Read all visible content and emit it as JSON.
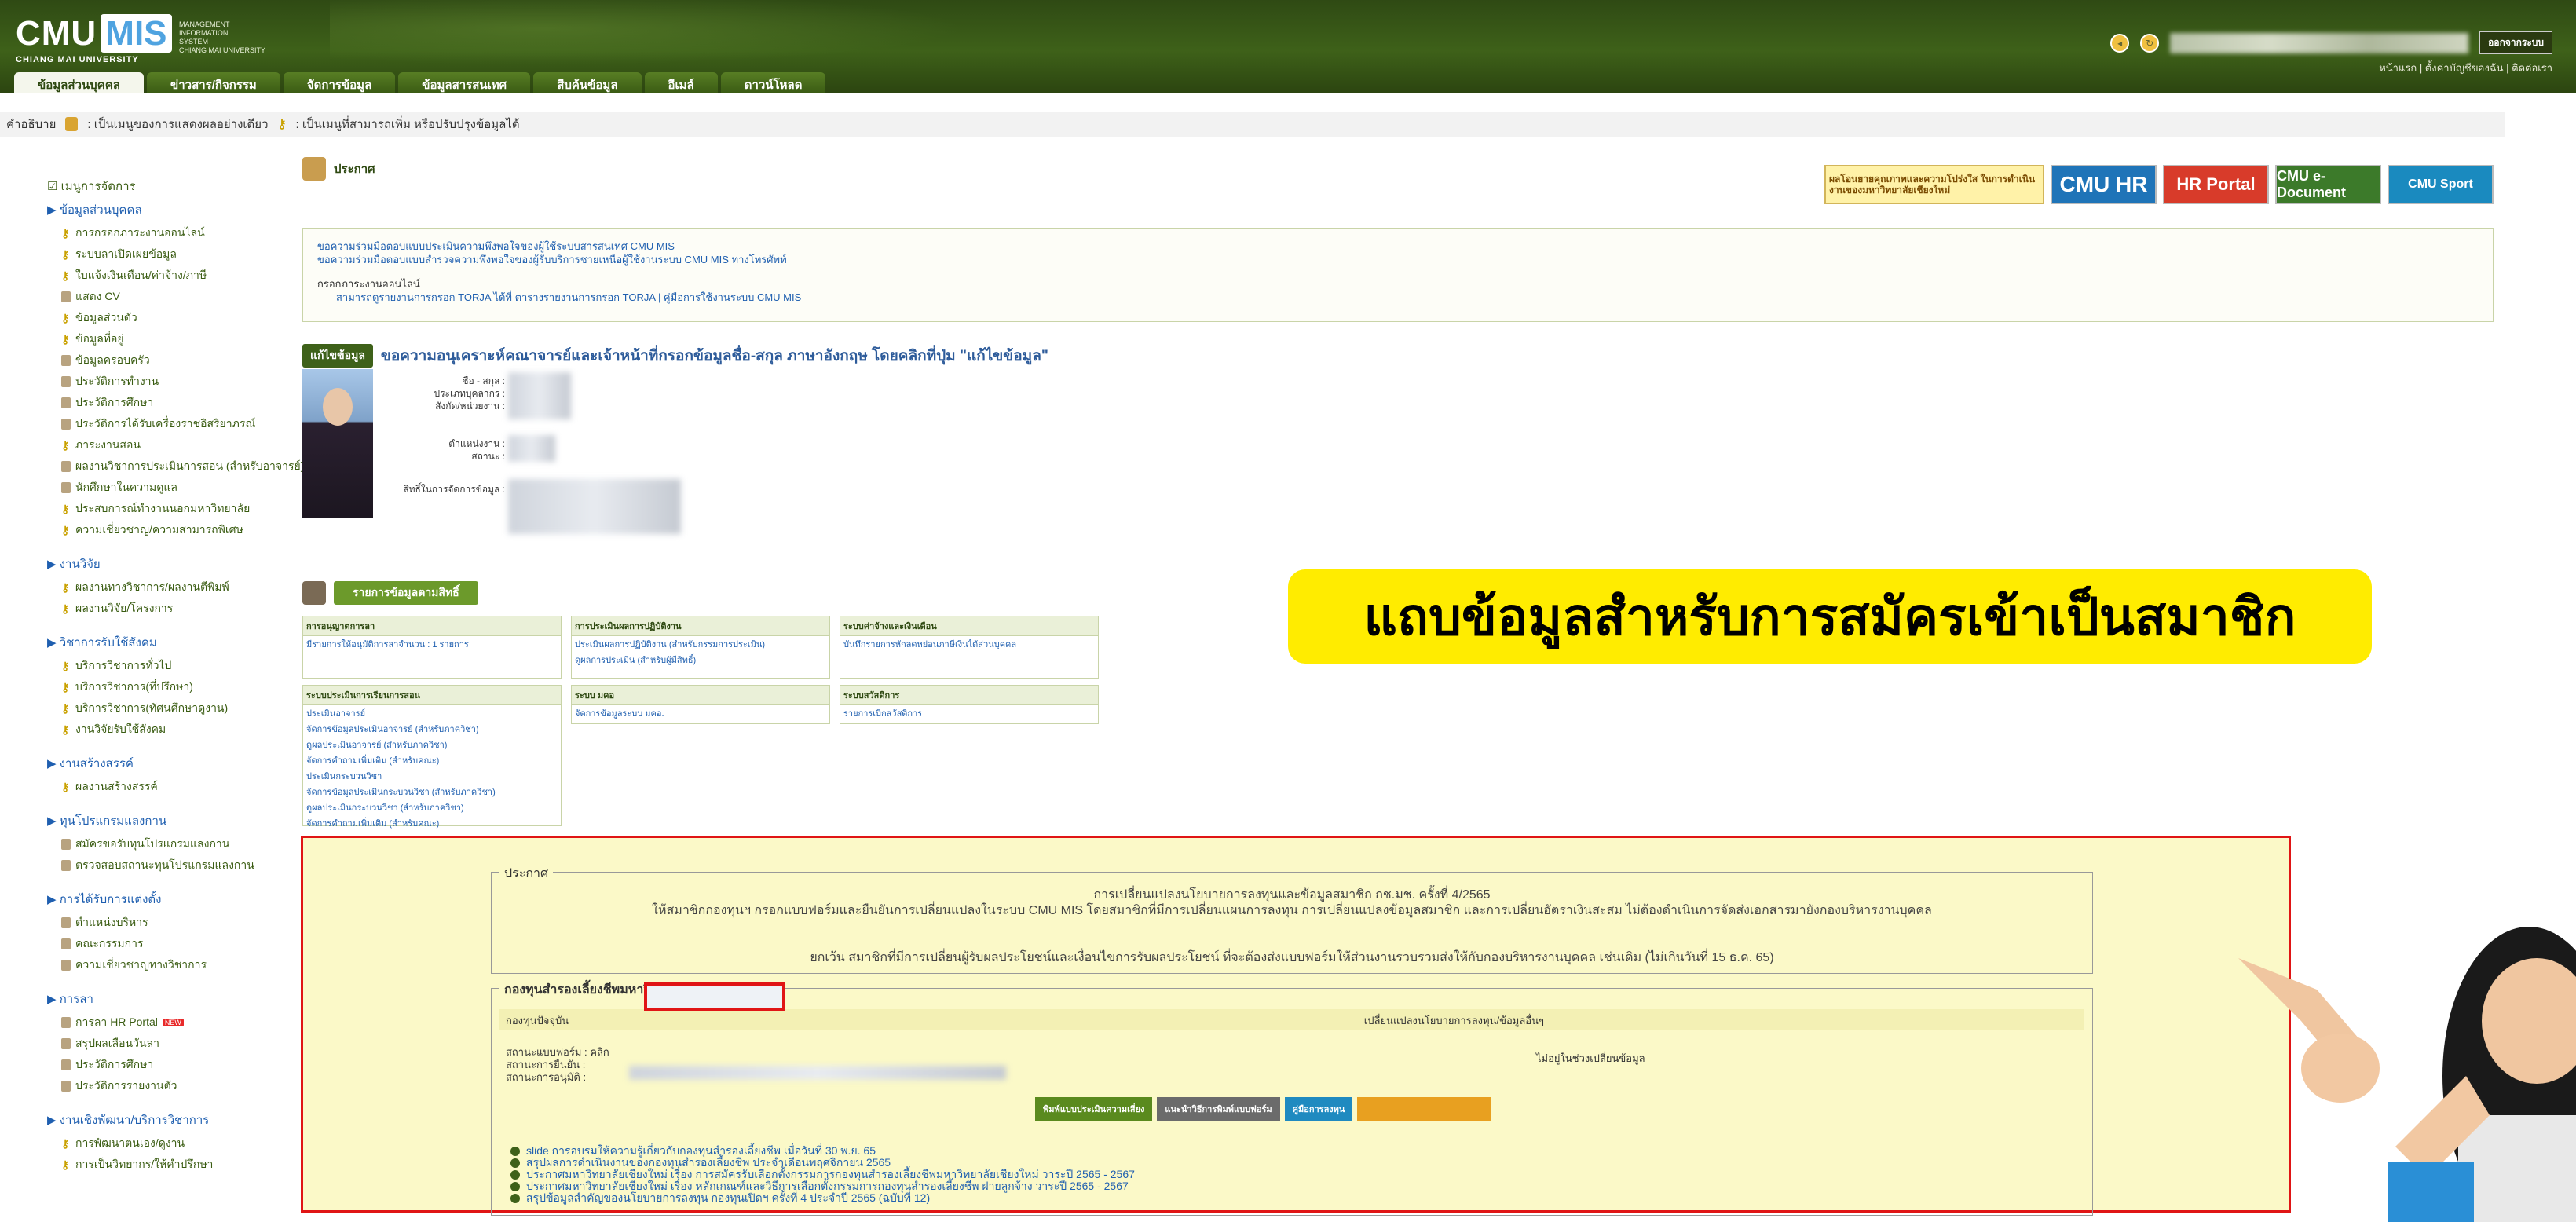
{
  "header": {
    "logo_cmu": "CMU",
    "logo_mis": "MIS",
    "logo_uni": "CHIANG MAI UNIVERSITY",
    "logo_sub": "MANAGEMENT\nINFORMATION\nSYSTEM\nCHIANG MAI UNIVERSITY",
    "logout_label": "ออกจากระบบ",
    "top_links": "หน้าแรก  |  ตั้งค่าบัญชีของฉัน  |  ติดต่อเรา",
    "tabs": [
      "ข้อมูลส่วนบุคคล",
      "ข่าวสาร/กิจกรรม",
      "จัดการข้อมูล",
      "ข้อมูลสารสนเทศ",
      "สืบค้นข้อมูล",
      "อีเมล์",
      "ดาวน์โหลด"
    ]
  },
  "legend": {
    "label": "คำอธิบาย",
    "lock_text": ": เป็นเมนูของการแสดงผลอย่างเดียว",
    "key_text": ": เป็นเมนูที่สามารถเพิ่ม หรือปรับปรุงข้อมูลได้"
  },
  "sidebar": {
    "title": "เมนูการจัดการ",
    "groups": [
      {
        "name": "ข้อมูลส่วนบุคคล",
        "items": [
          {
            "icon": "key",
            "label": "การกรอกภาระงานออนไลน์"
          },
          {
            "icon": "key",
            "label": "ระบบลาเปิดเผยข้อมูล"
          },
          {
            "icon": "key",
            "label": "ใบแจ้งเงินเดือน/ค่าจ้าง/ภาษี"
          },
          {
            "icon": "lock",
            "label": "แสดง CV"
          },
          {
            "icon": "key",
            "label": "ข้อมูลส่วนตัว"
          },
          {
            "icon": "key",
            "label": "ข้อมูลที่อยู่"
          },
          {
            "icon": "lock",
            "label": "ข้อมูลครอบครัว"
          },
          {
            "icon": "lock",
            "label": "ประวัติการทำงาน"
          },
          {
            "icon": "lock",
            "label": "ประวัติการศึกษา"
          },
          {
            "icon": "lock",
            "label": "ประวัติการได้รับเครื่องราชอิสริยาภรณ์"
          },
          {
            "icon": "key",
            "label": "ภาระงานสอน"
          },
          {
            "icon": "lock",
            "label": "ผลงานวิชาการประเมินการสอน (สำหรับอาจารย์)"
          },
          {
            "icon": "lock",
            "label": "นักศึกษาในความดูแล"
          },
          {
            "icon": "key",
            "label": "ประสบการณ์ทำงานนอกมหาวิทยาลัย"
          },
          {
            "icon": "key",
            "label": "ความเชี่ยวชาญ/ความสามารถพิเศษ"
          }
        ]
      },
      {
        "name": "งานวิจัย",
        "items": [
          {
            "icon": "key",
            "label": "ผลงานทางวิชาการ/ผลงานตีพิมพ์"
          },
          {
            "icon": "key",
            "label": "ผลงานวิจัย/โครงการ"
          }
        ]
      },
      {
        "name": "วิชาการรับใช้สังคม",
        "items": [
          {
            "icon": "key",
            "label": "บริการวิชาการทั่วไป"
          },
          {
            "icon": "key",
            "label": "บริการวิชาการ(ที่ปรึกษา)"
          },
          {
            "icon": "key",
            "label": "บริการวิชาการ(ทัศนศึกษาดูงาน)"
          },
          {
            "icon": "key",
            "label": "งานวิจัยรับใช้สังคม"
          }
        ]
      },
      {
        "name": "งานสร้างสรรค์",
        "items": [
          {
            "icon": "key",
            "label": "ผลงานสร้างสรรค์"
          }
        ]
      },
      {
        "name": "ทุนโปรแกรมแลงกาน",
        "items": [
          {
            "icon": "lock",
            "label": "สมัครขอรับทุนโปรแกรมแลงกาน"
          },
          {
            "icon": "lock",
            "label": "ตรวจสอบสถานะทุนโปรแกรมแลงกาน"
          }
        ]
      },
      {
        "name": "การได้รับการแต่งตั้ง",
        "items": [
          {
            "icon": "lock",
            "label": "ตำแหน่งบริหาร"
          },
          {
            "icon": "lock",
            "label": "คณะกรรมการ"
          },
          {
            "icon": "lock",
            "label": "ความเชี่ยวชาญทางวิชาการ"
          }
        ]
      },
      {
        "name": "การลา",
        "items": [
          {
            "icon": "lock",
            "label": "การลา HR Portal",
            "badge": "NEW"
          },
          {
            "icon": "lock",
            "label": "สรุปผลเลือนวันลา"
          },
          {
            "icon": "lock",
            "label": "ประวัติการศึกษา"
          },
          {
            "icon": "lock",
            "label": "ประวัติการรายงานตัว"
          }
        ]
      },
      {
        "name": "งานเชิงพัฒนา/บริการวิชาการ",
        "items": [
          {
            "icon": "key",
            "label": "การพัฒนาตนเอง/ดูงาน"
          },
          {
            "icon": "key",
            "label": "การเป็นวิทยากร/ให้คำปรึกษา"
          }
        ]
      }
    ]
  },
  "main": {
    "announce_title": "ประกาศ",
    "banners": {
      "b1": "ผลโอนยายคุณภาพและความโปร่งใส ในการดำเนินงานของมหาวิทยาลัยเชียงใหม่",
      "b2": "CMU HR",
      "b3": "HR Portal",
      "b4": "CMU e-Document",
      "b5": "CMU Sport"
    },
    "notice": {
      "line1": "ขอความร่วมมือตอบแบบประเมินความพึงพอใจของผู้ใช้ระบบสารสนเทศ CMU MIS",
      "line2": "ขอความร่วมมือตอบแบบสำรวจความพึงพอใจของผู้รับบริการชายเหนือผู้ใช้งานระบบ CMU MIS ทางโทรศัพท์",
      "line3": "กรอกภาระงานออนไลน์",
      "line4": "สามารถดูรายงานการกรอก TORJA ได้ที่ ตารางรายงานการกรอก TORJA  |  คู่มือการใช้งานระบบ CMU MIS"
    },
    "edit_button": "แก้ไขข้อมูล",
    "edit_text": "ขอความอนุเคราะห์คณาจารย์และเจ้าหน้าที่กรอกข้อมูลชื่อ-สกุล ภาษาอังกฤษ โดยคลิกที่ปุ่ม \"แก้ไขข้อมูล\"",
    "profile_labels": {
      "name": "ชื่อ - สกุล :",
      "type": "ประเภทบุคลากร :",
      "unit": "สังกัด/หน่วยงาน :",
      "position": "ตำแหน่งงาน :",
      "status": "สถานะ :",
      "rights": "สิทธิ์ในการจัดการข้อมูล :"
    },
    "perm_title": "รายการข้อมูลตามสิทธิ์",
    "perm_boxes": [
      {
        "head": "การอนุญาตการลา",
        "items": [
          "มีรายการให้อนุมัติการลาจำนวน : 1 รายการ"
        ]
      },
      {
        "head": "การประเมินผลการปฏิบัติงาน",
        "items": [
          "ประเมินผลการปฏิบัติงาน (สำหรับกรรมการประเมิน)",
          "ดูผลการประเมิน (สำหรับผู้มีสิทธิ์)"
        ]
      },
      {
        "head": "ระบบค่าจ้างและเงินเดือน",
        "items": [
          "บันทึกรายการหักลดหย่อนภาษีเงินได้ส่วนบุคคล"
        ]
      },
      {
        "head": "ระบบประเมินการเรียนการสอน",
        "items": [
          "ประเมินอาจารย์",
          "จัดการข้อมูลประเมินอาจารย์ (สำหรับภาควิชา)",
          "ดูผลประเมินอาจารย์ (สำหรับภาควิชา)",
          "จัดการคำถามเพิ่มเติม (สำหรับคณะ)",
          "ประเมินกระบวนวิชา",
          "จัดการข้อมูลประเมินกระบวนวิชา (สำหรับภาควิชา)",
          "ดูผลประเมินกระบวนวิชา (สำหรับภาควิชา)",
          "จัดการคำถามเพิ่มเติม (สำหรับคณะ)"
        ]
      },
      {
        "head": "ระบบ มคอ",
        "items": [
          "จัดการข้อมูลระบบ มคอ."
        ]
      },
      {
        "head": "ระบบสวัสดิการ",
        "items": [
          "รายการเบิกสวัสดิการ"
        ]
      }
    ],
    "highlight_banner": "แถบข้อมูลสำหรับการสมัครเข้าเป็นสมาชิก",
    "announce_fieldset": {
      "legend": "ประกาศ",
      "line1": "การเปลี่ยนแปลงนโยบายการลงทุนและข้อมูลสมาชิก กช.มช. ครั้งที่ 4/2565",
      "line2": "ให้สมาชิกกองทุนฯ กรอกแบบฟอร์มและยืนยันการเปลี่ยนแปลงในระบบ CMU MIS โดยสมาชิกที่มีการเปลี่ยนแผนการลงทุน การเปลี่ยนแปลงข้อมูลสมาชิก และการเปลี่ยนอัตราเงินสะสม ไม่ต้องดำเนินการจัดส่งเอกสารมายังกองบริหารงานบุคคล",
      "line3": "ยกเว้น สมาชิกที่มีการเปลี่ยนผู้รับผลประโยชน์และเงื่อนไขการรับผลประโยชน์ ที่จะต้องส่งแบบฟอร์มให้ส่วนงานรวบรวมส่งให้กับกองบริหารงานบุคคล เช่นเดิม (ไม่เกินวันที่ 15 ธ.ค. 65)"
    },
    "fund_fieldset": {
      "legend": "กองทุนสำรองเลี้ยงชีพมหาวิทยาลัยเชียงใหม่",
      "head_left": "กองทุนปัจจุบัน",
      "head_right": "เปลี่ยนแปลงนโยบายการลงทุน/ข้อมูลอื่นๆ",
      "row1": "สถานะแบบฟอร์ม : คลิก",
      "row2": "สถานะการยืนยัน :",
      "row3": "สถานะการอนุมัติ :",
      "right_status": "ไม่อยู่ในช่วงเปลี่ยนข้อมูล",
      "buttons": [
        "พิมพ์แบบประเมินความเสี่ยง",
        "แนะนำวิธีการพิมพ์แบบฟอร์ม",
        "คู่มือการลงทุน"
      ],
      "links": [
        "slide การอบรมให้ความรู้เกี่ยวกับกองทุนสำรองเลี้ยงชีพ เมื่อวันที่ 30 พ.ย. 65",
        "สรุปผลการดำเนินงานของกองทุนสำรองเลี้ยงชีพ ประจำเดือนพฤศจิกายน 2565",
        "ประกาศมหาวิทยาลัยเชียงใหม่ เรื่อง การสมัครรับเลือกตั้งกรรมการกองทุนสำรองเลี้ยงชีพมหาวิทยาลัยเชียงใหม่ วาระปี 2565 - 2567",
        "ประกาศมหาวิทยาลัยเชียงใหม่ เรื่อง หลักเกณฑ์และวิธีการเลือกตั้งกรรมการกองทุนสำรองเลี้ยงชีพ ฝ่ายลูกจ้าง วาระปี 2565 - 2567",
        "สรุปข้อมูลสำคัญของนโยบายการลงทุน กองทุนเปิดฯ ครั้งที่ 4 ประจำปี 2565 (ฉบับที่ 12)"
      ]
    }
  },
  "colors": {
    "header_green": "#3e6119",
    "highlight_yellow": "#ffec00",
    "frame_red": "#e01515",
    "panel_yellow": "#fbf9c8",
    "link_blue": "#2060b0"
  }
}
